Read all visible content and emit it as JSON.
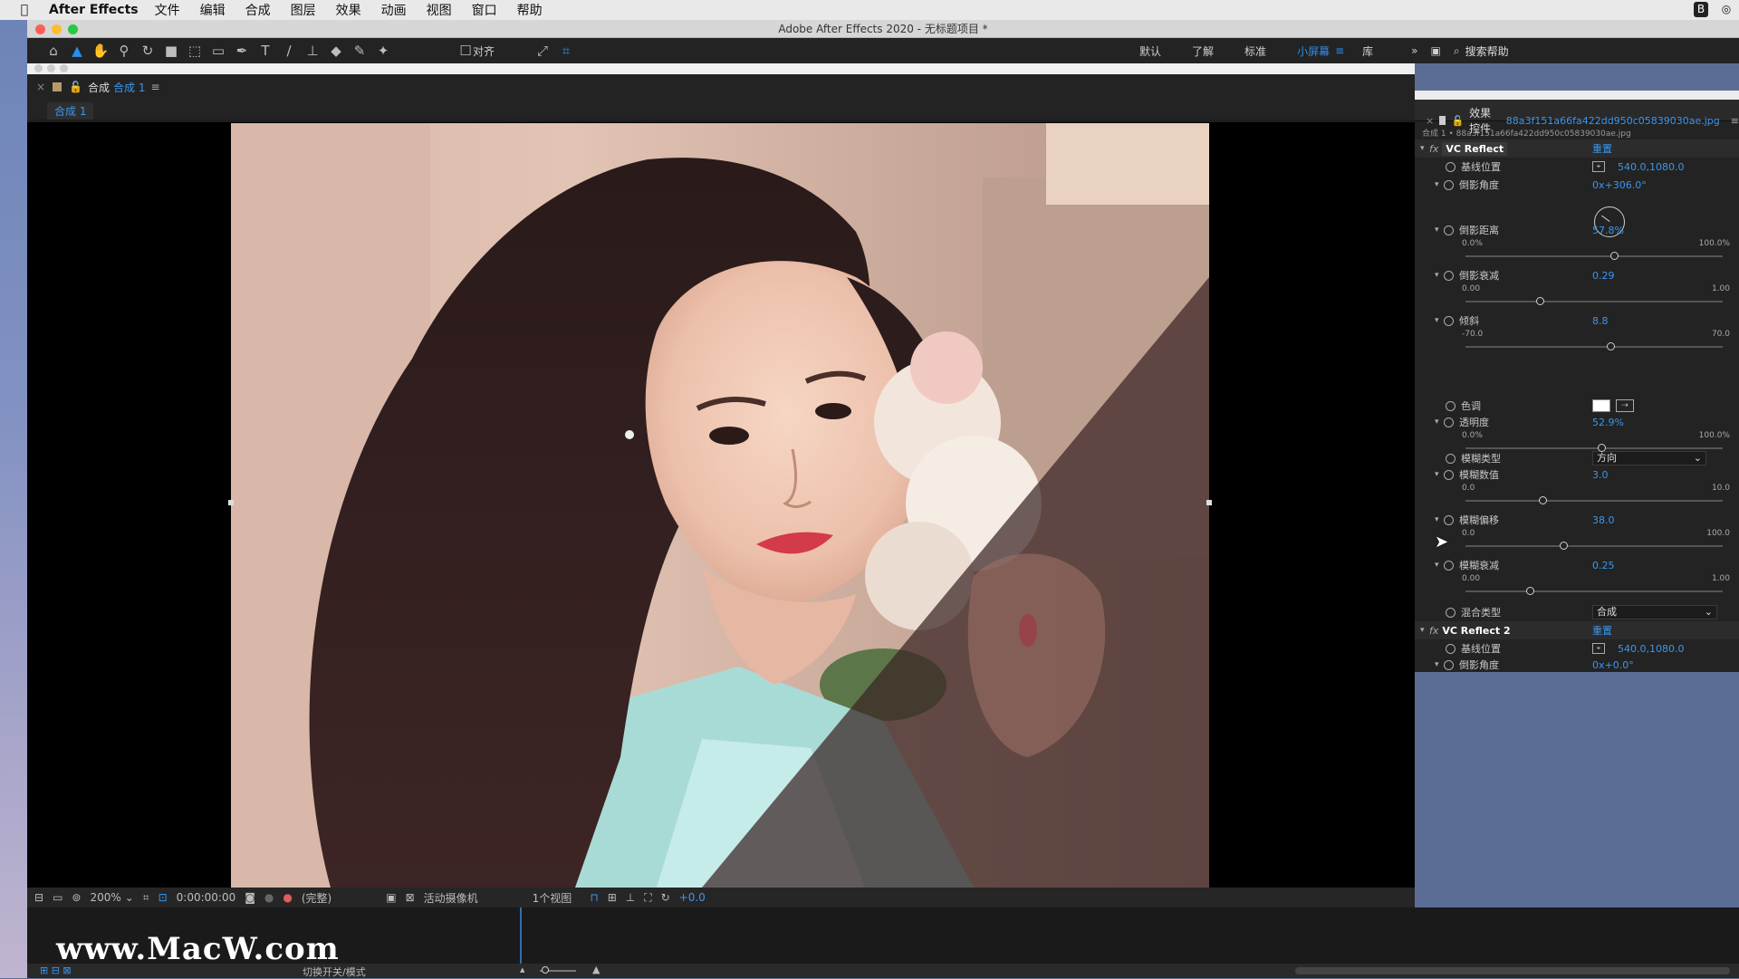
{
  "menubar": {
    "app_name": "After Effects",
    "items": [
      "文件",
      "编辑",
      "合成",
      "图层",
      "效果",
      "动画",
      "视图",
      "窗口",
      "帮助"
    ]
  },
  "window": {
    "title": "Adobe After Effects 2020 - 无标题项目 *"
  },
  "toolbar": {
    "align_label": "对齐",
    "workspaces": [
      "默认",
      "了解",
      "标准",
      "小屏幕",
      "库"
    ],
    "active_workspace": "小屏幕",
    "search_placeholder": "搜索帮助"
  },
  "comp": {
    "panel_label": "合成",
    "comp_name": "合成 1",
    "subtab": "合成 1"
  },
  "viewer_bar": {
    "zoom": "200%",
    "timecode": "0:00:00:00",
    "quality": "(完整)",
    "camera": "活动摄像机",
    "views": "1个视图",
    "exposure": "+0.0"
  },
  "effects": {
    "panel_title": "效果控件",
    "file_name": "88a3f151a66fa422dd950c05839030ae.jpg",
    "breadcrumb": "合成 1 • 88a3f151a66fa422dd950c05839030ae.jpg",
    "effect1": {
      "name": "VC Reflect",
      "reset": "重置",
      "baseline_label": "基线位置",
      "baseline_value": "540.0,1080.0",
      "angle_label": "倒影角度",
      "angle_value": "0x+306.0°",
      "distance_label": "倒影距离",
      "distance_value": "57.8%",
      "distance_min": "0.0%",
      "distance_max": "100.0%",
      "falloff_label": "倒影衰减",
      "falloff_value": "0.29",
      "falloff_min": "0.00",
      "falloff_max": "1.00",
      "skew_label": "倾斜",
      "skew_value": "8.8",
      "skew_min": "-70.0",
      "skew_max": "70.0",
      "tint_label": "色调",
      "opacity_label": "透明度",
      "opacity_value": "52.9%",
      "opacity_min": "0.0%",
      "opacity_max": "100.0%",
      "blurtype_label": "模糊类型",
      "blurtype_value": "方向",
      "blurval_label": "模糊数值",
      "blurval_value": "3.0",
      "blurval_min": "0.0",
      "blurval_max": "10.0",
      "bluroffset_label": "模糊偏移",
      "bluroffset_value": "38.0",
      "bluroffset_min": "0.0",
      "bluroffset_max": "100.0",
      "blurfalloff_label": "模糊衰减",
      "blurfalloff_value": "0.25",
      "blurfalloff_min": "0.00",
      "blurfalloff_max": "1.00",
      "blend_label": "混合类型",
      "blend_value": "合成"
    },
    "effect2": {
      "name": "VC Reflect 2",
      "reset": "重置",
      "baseline_label": "基线位置",
      "baseline_value": "540.0,1080.0",
      "angle_label": "倒影角度",
      "angle_value": "0x+0.0°"
    },
    "levels": {
      "distance": 0.578,
      "falloff": 0.29,
      "skew": 0.563,
      "opacity": 0.529,
      "blurval": 0.3,
      "bluroffset": 0.38,
      "blurfalloff": 0.25
    }
  },
  "timeline": {
    "switch_label": "切换开关/模式"
  },
  "watermark": "www.MacW.com"
}
